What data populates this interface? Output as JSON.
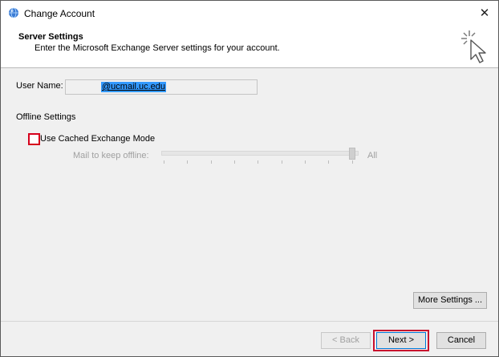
{
  "window": {
    "title": "Change Account",
    "app_icon": "outlook-globe-icon",
    "close_glyph": "✕"
  },
  "header": {
    "title": "Server Settings",
    "subtitle": "Enter the Microsoft Exchange Server settings for your account.",
    "icon": "wizard-cursor-icon"
  },
  "form": {
    "username_label": "User Name:",
    "username_value": "@ucmail.uc.edu",
    "offline_section_label": "Offline Settings",
    "cached_mode_label": "Use Cached Exchange Mode",
    "cached_mode_checked": false,
    "mail_keep_offline_label": "Mail to keep offline:",
    "mail_keep_offline_value": "All",
    "mail_keep_offline_enabled": false
  },
  "buttons": {
    "more_settings": "More Settings ...",
    "back": "< Back",
    "next": "Next >",
    "cancel": "Cancel"
  },
  "colors": {
    "highlight_outline": "#c8102e",
    "selection": "#3399ff",
    "dialog_bg": "#f0f0f0"
  }
}
